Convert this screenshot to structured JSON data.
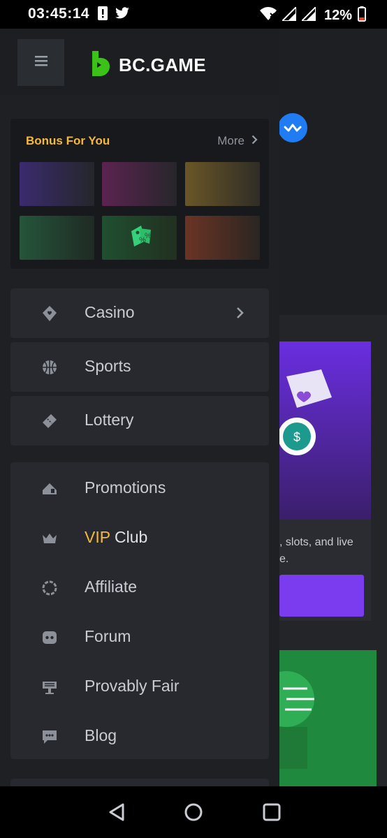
{
  "status_bar": {
    "time": "03:45:14",
    "battery": "12%",
    "icons": [
      "alert-icon",
      "twitter-icon",
      "wifi-icon",
      "signal-icon",
      "signal-icon",
      "battery-icon"
    ]
  },
  "header": {
    "menu_icon": "hamburger-icon",
    "logo_text": "BC.GAME"
  },
  "bonus": {
    "title": "Bonus For You",
    "more_label": "More",
    "tiles": [
      {
        "color_a": "#3a2b6e",
        "color_b": "#25262b"
      },
      {
        "color_a": "#5b2350",
        "color_b": "#27262b"
      },
      {
        "color_a": "#6a5627",
        "color_b": "#2f2d26"
      },
      {
        "color_a": "#25553a",
        "color_b": "#1f2a24"
      },
      {
        "color_a": "#1f4f30",
        "color_b": "#22301f",
        "icon": "discount-tag-icon"
      },
      {
        "color_a": "#6b3424",
        "color_b": "#2a2522"
      }
    ]
  },
  "main_nav": [
    {
      "label": "Casino",
      "icon": "casino-icon",
      "has_chevron": true
    },
    {
      "label": "Sports",
      "icon": "basketball-icon"
    },
    {
      "label": "Lottery",
      "icon": "lottery-ticket-icon"
    }
  ],
  "secondary_nav": [
    {
      "label": "Promotions",
      "icon": "promotions-icon"
    },
    {
      "label_highlight": "VIP",
      "label_rest": "Club",
      "icon": "crown-icon"
    },
    {
      "label": "Affiliate",
      "icon": "affiliate-icon"
    },
    {
      "label": "Forum",
      "icon": "forum-icon"
    },
    {
      "label": "Provably Fair",
      "icon": "provably-fair-icon"
    },
    {
      "label": "Blog",
      "icon": "blog-icon"
    }
  ],
  "background_page": {
    "snippet_line1": ", slots, and live",
    "snippet_line2": "e."
  },
  "colors": {
    "accent_gold": "#f5b93a",
    "brand_green": "#3bc117",
    "drawer_bg": "#1e2024",
    "item_bg": "#27292e"
  },
  "navbar": {
    "icons": [
      "back-icon",
      "home-icon",
      "recents-icon"
    ]
  }
}
